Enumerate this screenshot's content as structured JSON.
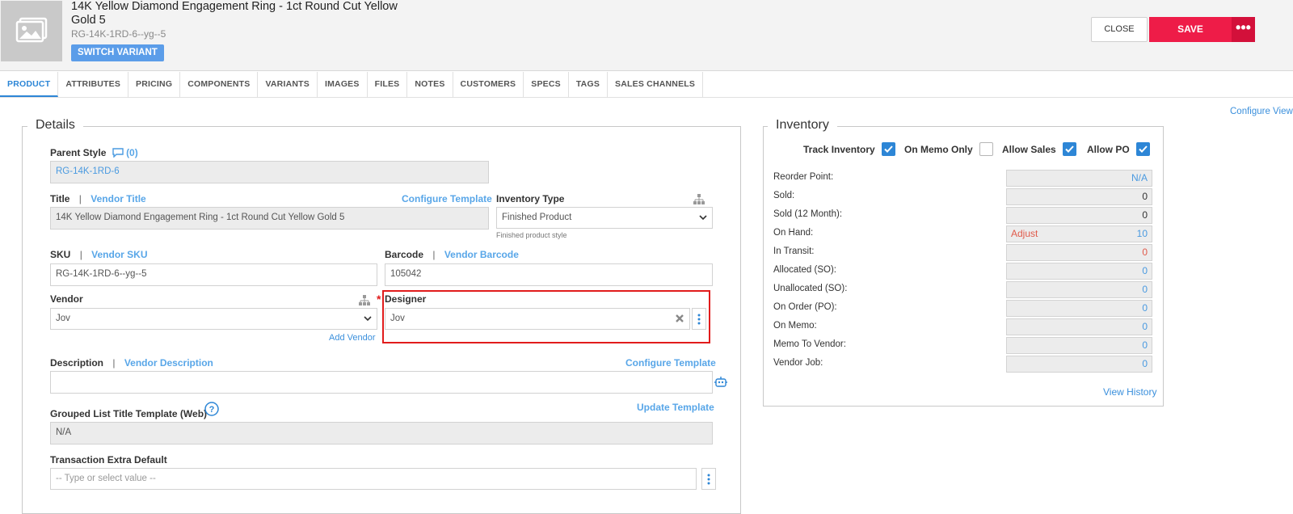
{
  "header": {
    "title": "14K Yellow Diamond Engagement Ring - 1ct Round Cut Yellow Gold 5",
    "sku": "RG-14K-1RD-6--yg--5",
    "switch_variant": "SWITCH VARIANT",
    "close": "CLOSE",
    "save": "SAVE",
    "more": "•••"
  },
  "tabs": [
    "PRODUCT",
    "ATTRIBUTES",
    "PRICING",
    "COMPONENTS",
    "VARIANTS",
    "IMAGES",
    "FILES",
    "NOTES",
    "CUSTOMERS",
    "SPECS",
    "TAGS",
    "SALES CHANNELS"
  ],
  "configure_view": "Configure View",
  "details": {
    "legend": "Details",
    "parent_style_label": "Parent Style",
    "parent_style_count": "(0)",
    "parent_style_value": "RG-14K-1RD-6",
    "title_label": "Title",
    "vendor_title": "Vendor Title",
    "configure_template": "Configure Template",
    "title_value": "14K Yellow Diamond Engagement Ring - 1ct Round Cut Yellow Gold 5",
    "inventory_type_label": "Inventory Type",
    "inventory_type_value": "Finished Product",
    "inventory_type_hint": "Finished product style",
    "sku_label": "SKU",
    "vendor_sku": "Vendor SKU",
    "sku_value": "RG-14K-1RD-6--yg--5",
    "barcode_label": "Barcode",
    "vendor_barcode": "Vendor Barcode",
    "barcode_value": "105042",
    "vendor_label": "Vendor",
    "vendor_value": "Jov",
    "add_vendor": "Add Vendor",
    "designer_label": "Designer",
    "required_mark": "*",
    "designer_value": "Jov",
    "description_label": "Description",
    "vendor_description": "Vendor Description",
    "description_configure_template": "Configure Template",
    "description_value": "",
    "grouped_label": "Grouped List Title Template (Web)",
    "update_template": "Update Template",
    "grouped_value": "N/A",
    "transaction_label": "Transaction Extra Default",
    "transaction_placeholder": "-- Type or select value --"
  },
  "inventory": {
    "legend": "Inventory",
    "checks": [
      {
        "label": "Track Inventory",
        "checked": true
      },
      {
        "label": "On Memo Only",
        "checked": false
      },
      {
        "label": "Allow Sales",
        "checked": true
      },
      {
        "label": "Allow PO",
        "checked": true
      }
    ],
    "rows": [
      {
        "label": "Reorder Point:",
        "value": "N/A",
        "color": "#4a9ae0"
      },
      {
        "label": "Sold:",
        "value": "0",
        "color": "#333333"
      },
      {
        "label": "Sold (12 Month):",
        "value": "0",
        "color": "#333333"
      },
      {
        "label": "On Hand:",
        "value": "10",
        "color": "#4a9ae0",
        "prefix": "Adjust"
      },
      {
        "label": "In Transit:",
        "value": "0",
        "color": "#e05a4a"
      },
      {
        "label": "Allocated (SO):",
        "value": "0",
        "color": "#4a9ae0"
      },
      {
        "label": "Unallocated (SO):",
        "value": "0",
        "color": "#4a9ae0"
      },
      {
        "label": "On Order (PO):",
        "value": "0",
        "color": "#4a9ae0"
      },
      {
        "label": "On Memo:",
        "value": "0",
        "color": "#4a9ae0"
      },
      {
        "label": "Memo To Vendor:",
        "value": "0",
        "color": "#4a9ae0"
      },
      {
        "label": "Vendor Job:",
        "value": "0",
        "color": "#4a9ae0"
      }
    ],
    "view_history": "View History"
  },
  "colors": {
    "accent": "#2d86d6",
    "link": "#58a6e8",
    "save": "#ee1c48",
    "highlight": "#e11c1c",
    "adjust": "#e05a4a"
  }
}
